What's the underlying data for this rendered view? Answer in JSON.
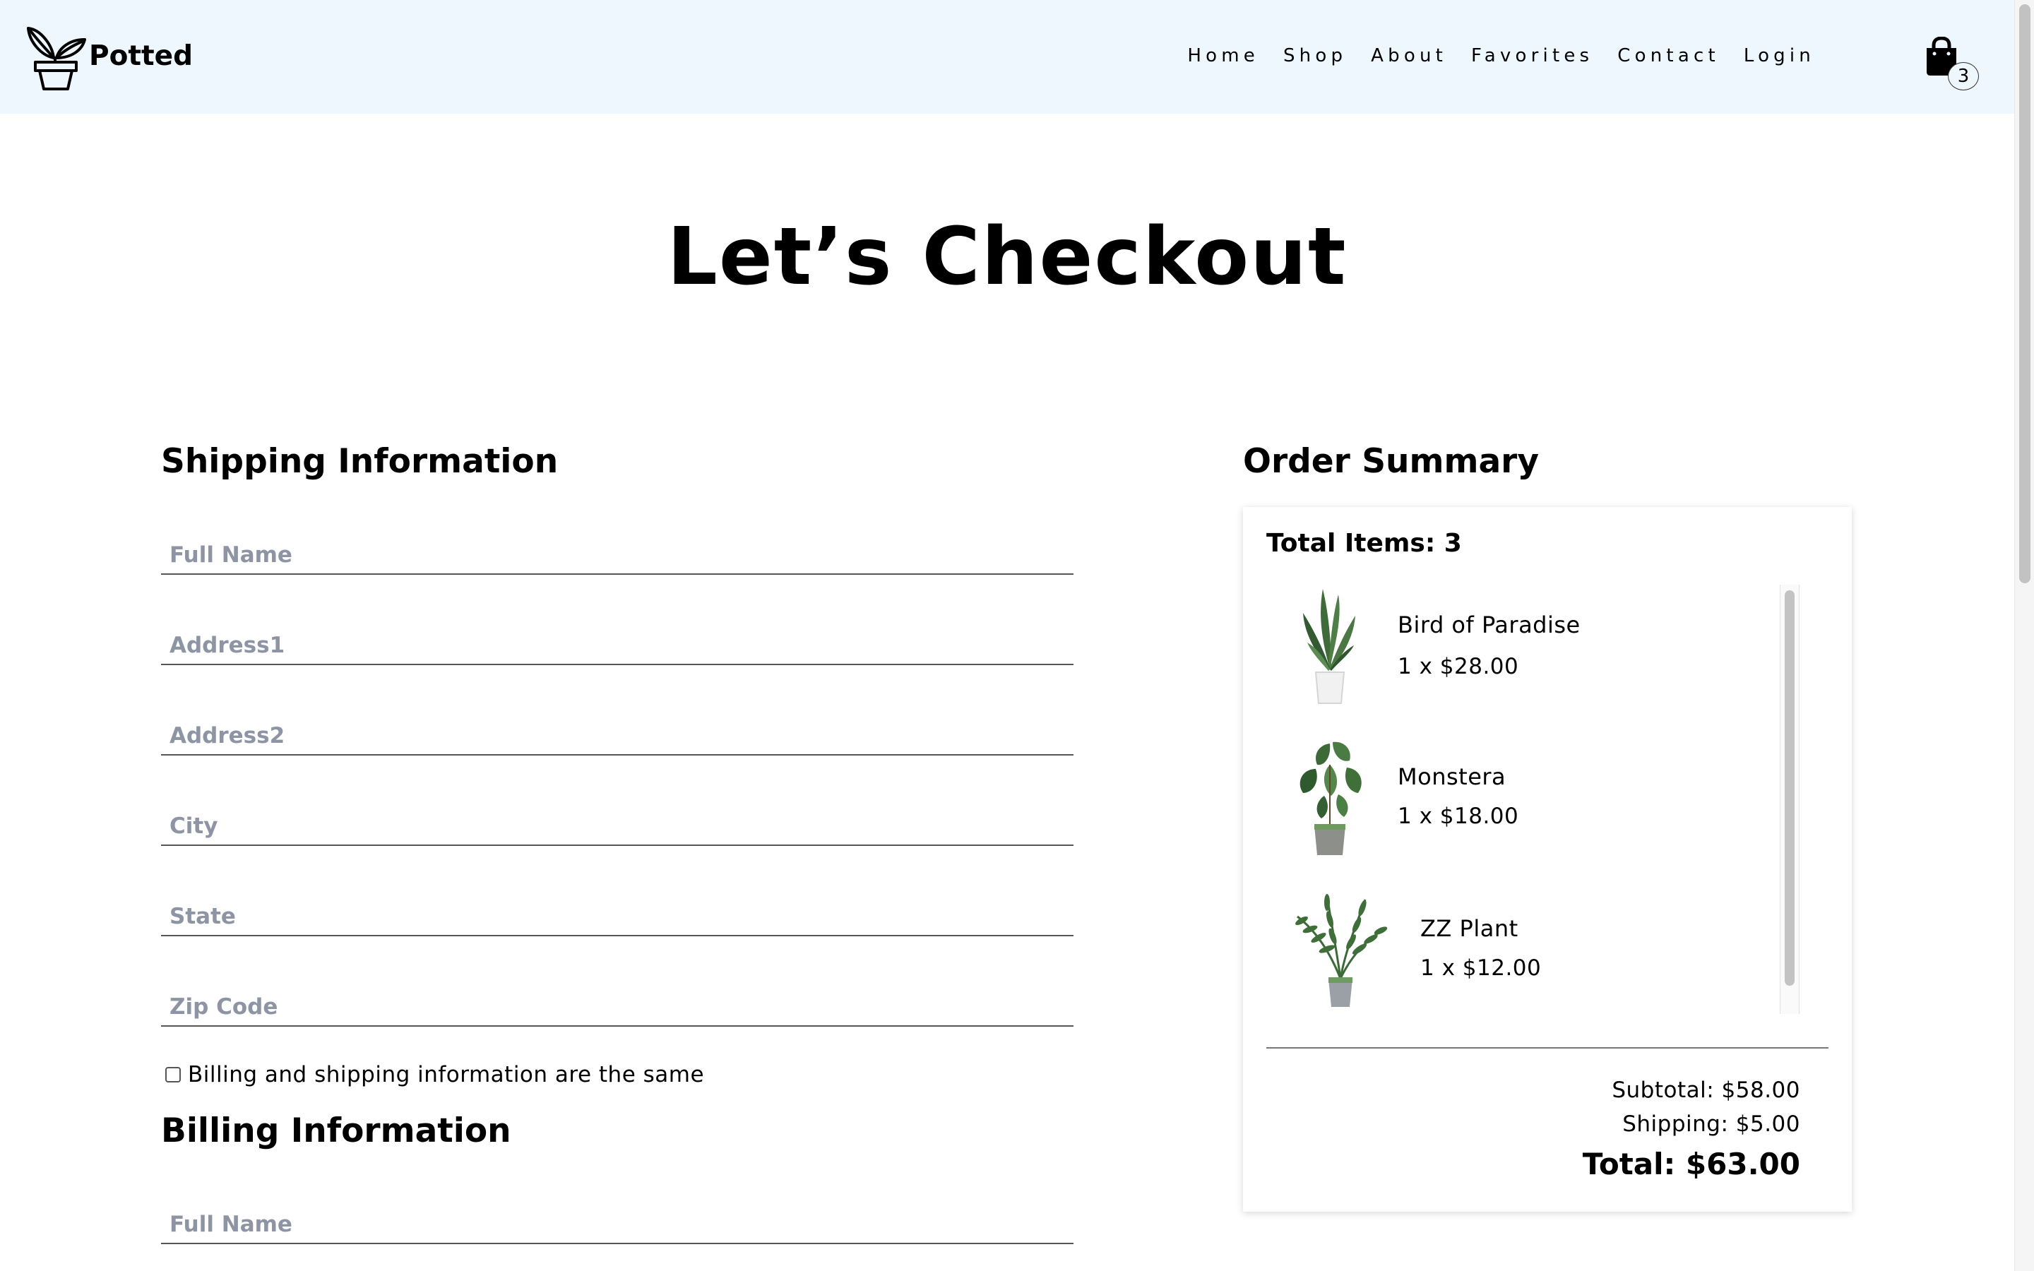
{
  "brand": {
    "name": "Potted"
  },
  "nav": {
    "links": [
      "Home",
      "Shop",
      "About",
      "Favorites",
      "Contact",
      "Login"
    ],
    "cart_count": "3"
  },
  "page": {
    "title": "Let’s Checkout"
  },
  "shipping": {
    "heading": "Shipping Information",
    "fields": {
      "full_name": "Full Name",
      "address1": "Address1",
      "address2": "Address2",
      "city": "City",
      "state": "State",
      "zip": "Zip Code"
    },
    "same_label": "Billing and shipping information are the same"
  },
  "billing": {
    "heading": "Billing Information",
    "fields": {
      "full_name": "Full Name"
    }
  },
  "summary": {
    "heading": "Order Summary",
    "total_items": "Total Items: 3",
    "items": [
      {
        "name": "Bird of Paradise",
        "price": "1 x $28.00"
      },
      {
        "name": "Monstera",
        "price": "1 x $18.00"
      },
      {
        "name": "ZZ Plant",
        "price": "1 x $12.00"
      }
    ],
    "subtotal": "Subtotal: $58.00",
    "shipping": "Shipping: $5.00",
    "total": "Total: $63.00"
  },
  "colors": {
    "navbar_bg": "#eef6fe",
    "placeholder": "#8d94a3",
    "plant_green": "#3f6b3a",
    "pot_gray": "#9a9a9a"
  },
  "icons": {
    "logo": "plant-pot-icon",
    "cart": "shopping-bag-icon"
  }
}
